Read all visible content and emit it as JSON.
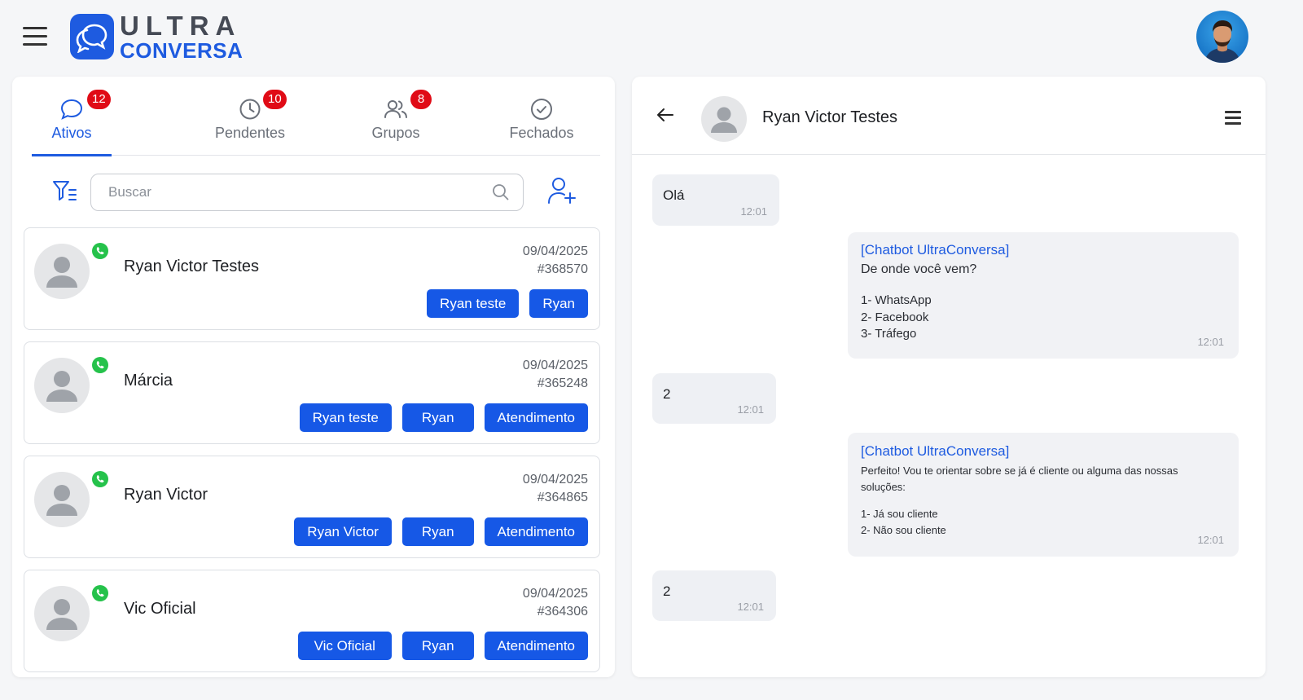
{
  "app": {
    "logo_line1": "ULTRA",
    "logo_line2": "CONVERSA",
    "brand_color": "#1e5be0",
    "badge_color": "#e00b16"
  },
  "tabs": [
    {
      "label": "Ativos",
      "badge": "12",
      "icon": "chat-bubble-icon",
      "active": true
    },
    {
      "label": "Pendentes",
      "badge": "10",
      "icon": "clock-icon",
      "active": false
    },
    {
      "label": "Grupos",
      "badge": "8",
      "icon": "users-icon",
      "active": false
    },
    {
      "label": "Fechados",
      "badge": "",
      "icon": "check-circle-icon",
      "active": false
    }
  ],
  "search": {
    "placeholder": "Buscar"
  },
  "contacts": [
    {
      "name": "Ryan Victor Testes",
      "date": "09/04/2025",
      "id": "#368570",
      "tags": [
        "Ryan teste",
        "Ryan"
      ]
    },
    {
      "name": "Márcia",
      "date": "09/04/2025",
      "id": "#365248",
      "tags": [
        "Ryan teste",
        "Ryan",
        "Atendimento"
      ]
    },
    {
      "name": "Ryan Victor",
      "date": "09/04/2025",
      "id": "#364865",
      "tags": [
        "Ryan Victor",
        "Ryan",
        "Atendimento"
      ]
    },
    {
      "name": "Vic Oficial",
      "date": "09/04/2025",
      "id": "#364306",
      "tags": [
        "Vic Oficial",
        "Ryan",
        "Atendimento"
      ]
    }
  ],
  "chat": {
    "contact_name": "Ryan Victor Testes",
    "messages": [
      {
        "from": "contact",
        "text": "Olá",
        "time": "12:01"
      },
      {
        "from": "bot",
        "title": "[Chatbot UltraConversa]",
        "text": "De onde você vem?",
        "options": [
          "1- WhatsApp",
          "2- Facebook",
          "3- Tráfego"
        ],
        "time": "12:01"
      },
      {
        "from": "contact",
        "text": "2",
        "time": "12:01"
      },
      {
        "from": "bot",
        "title": "[Chatbot UltraConversa]",
        "text_line1": "Perfeito! Vou te orientar sobre se já é cliente ou alguma das nossas",
        "text_line2": "soluções:",
        "options": [
          "1- Já sou cliente",
          "2- Não sou cliente"
        ],
        "time": "12:01"
      },
      {
        "from": "contact",
        "text": "2",
        "time": "12:01"
      }
    ]
  }
}
